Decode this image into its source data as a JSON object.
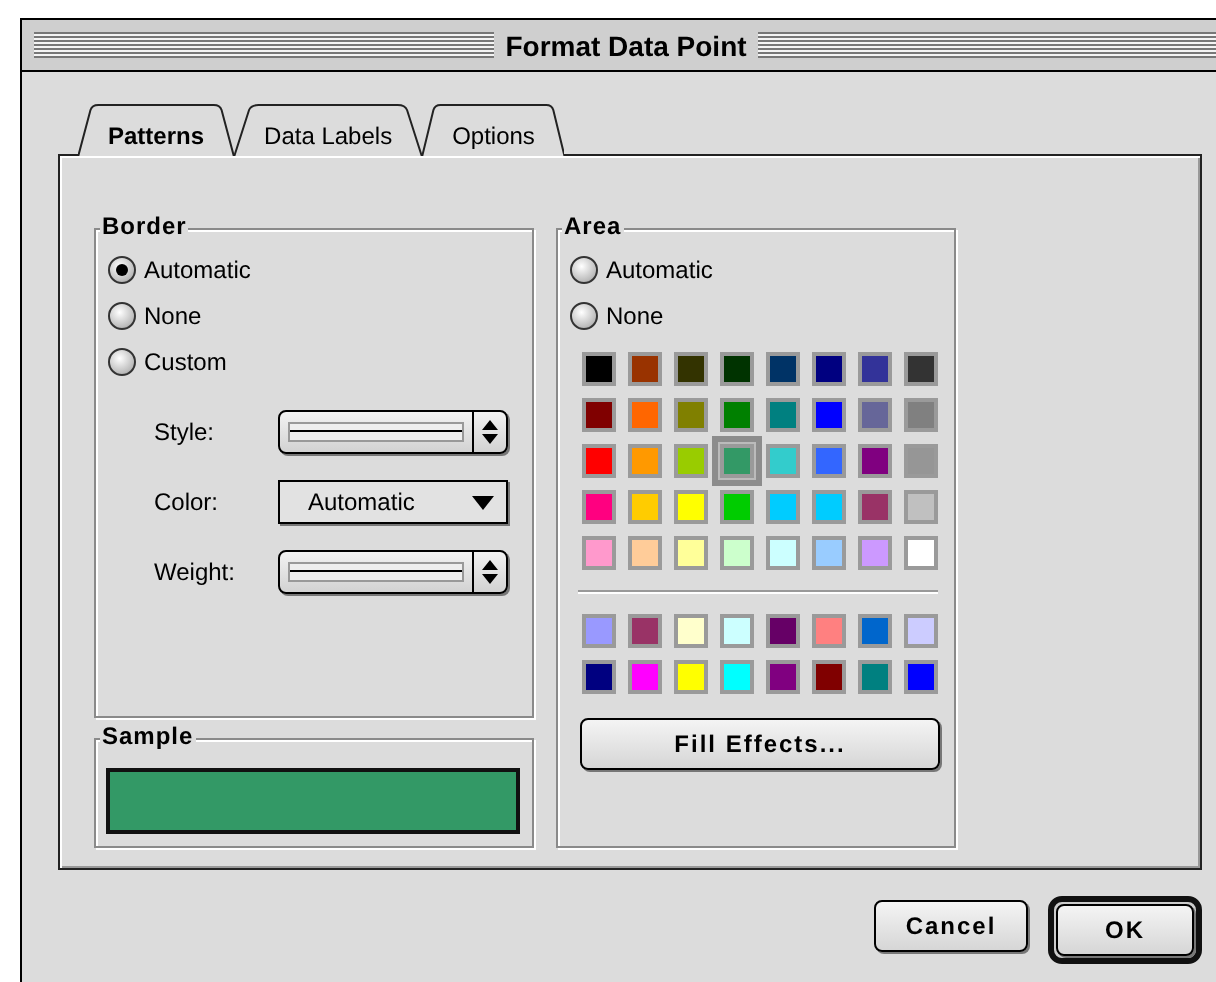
{
  "window": {
    "title": "Format Data Point"
  },
  "tabs": [
    {
      "label": "Patterns",
      "selected": true
    },
    {
      "label": "Data Labels",
      "selected": false
    },
    {
      "label": "Options",
      "selected": false
    }
  ],
  "border": {
    "title": "Border",
    "options": [
      {
        "label": "Automatic",
        "selected": true
      },
      {
        "label": "None",
        "selected": false
      },
      {
        "label": "Custom",
        "selected": false
      }
    ],
    "settings": [
      {
        "kind": "line",
        "label": "Style:"
      },
      {
        "kind": "dropdown",
        "label": "Color:",
        "value": "Automatic"
      },
      {
        "kind": "line",
        "label": "Weight:"
      }
    ]
  },
  "sample": {
    "title": "Sample",
    "color": "#339966"
  },
  "area": {
    "title": "Area",
    "options": [
      {
        "label": "Automatic",
        "selected": false
      },
      {
        "label": "None",
        "selected": false
      }
    ],
    "palette": [
      {
        "color": "#000000",
        "selected": false
      },
      {
        "color": "#993300",
        "selected": false
      },
      {
        "color": "#333300",
        "selected": false
      },
      {
        "color": "#003300",
        "selected": false
      },
      {
        "color": "#003366",
        "selected": false
      },
      {
        "color": "#000080",
        "selected": false
      },
      {
        "color": "#333399",
        "selected": false
      },
      {
        "color": "#333333",
        "selected": false
      },
      {
        "color": "#800000",
        "selected": false
      },
      {
        "color": "#ff6600",
        "selected": false
      },
      {
        "color": "#808000",
        "selected": false
      },
      {
        "color": "#008000",
        "selected": false
      },
      {
        "color": "#008080",
        "selected": false
      },
      {
        "color": "#0000ff",
        "selected": false
      },
      {
        "color": "#666699",
        "selected": false
      },
      {
        "color": "#808080",
        "selected": false
      },
      {
        "color": "#ff0000",
        "selected": false
      },
      {
        "color": "#ff9900",
        "selected": false
      },
      {
        "color": "#99cc00",
        "selected": false
      },
      {
        "color": "#339966",
        "selected": true
      },
      {
        "color": "#33cccc",
        "selected": false
      },
      {
        "color": "#3366ff",
        "selected": false
      },
      {
        "color": "#800080",
        "selected": false
      },
      {
        "color": "#969696",
        "selected": false
      },
      {
        "color": "#ff0080",
        "selected": false
      },
      {
        "color": "#ffcc00",
        "selected": false
      },
      {
        "color": "#ffff00",
        "selected": false
      },
      {
        "color": "#00cc00",
        "selected": false
      },
      {
        "color": "#00ccff",
        "selected": false
      },
      {
        "color": "#00ccff",
        "selected": false
      },
      {
        "color": "#993366",
        "selected": false
      },
      {
        "color": "#c0c0c0",
        "selected": false
      },
      {
        "color": "#ff99cc",
        "selected": false
      },
      {
        "color": "#ffcc99",
        "selected": false
      },
      {
        "color": "#ffff99",
        "selected": false
      },
      {
        "color": "#ccffcc",
        "selected": false
      },
      {
        "color": "#ccffff",
        "selected": false
      },
      {
        "color": "#99ccff",
        "selected": false
      },
      {
        "color": "#cc99ff",
        "selected": false
      },
      {
        "color": "#ffffff",
        "selected": false
      }
    ],
    "chart_palette": [
      {
        "color": "#9999ff",
        "selected": false
      },
      {
        "color": "#993366",
        "selected": false
      },
      {
        "color": "#ffffcc",
        "selected": false
      },
      {
        "color": "#ccffff",
        "selected": false
      },
      {
        "color": "#660066",
        "selected": false
      },
      {
        "color": "#ff8080",
        "selected": false
      },
      {
        "color": "#0066cc",
        "selected": false
      },
      {
        "color": "#ccccff",
        "selected": false
      },
      {
        "color": "#000080",
        "selected": false
      },
      {
        "color": "#ff00ff",
        "selected": false
      },
      {
        "color": "#ffff00",
        "selected": false
      },
      {
        "color": "#00ffff",
        "selected": false
      },
      {
        "color": "#800080",
        "selected": false
      },
      {
        "color": "#800000",
        "selected": false
      },
      {
        "color": "#008080",
        "selected": false
      },
      {
        "color": "#0000ff",
        "selected": false
      }
    ],
    "button": "Fill Effects..."
  },
  "buttons": [
    {
      "label": "Cancel",
      "default": false
    },
    {
      "label": "OK",
      "default": true
    }
  ]
}
